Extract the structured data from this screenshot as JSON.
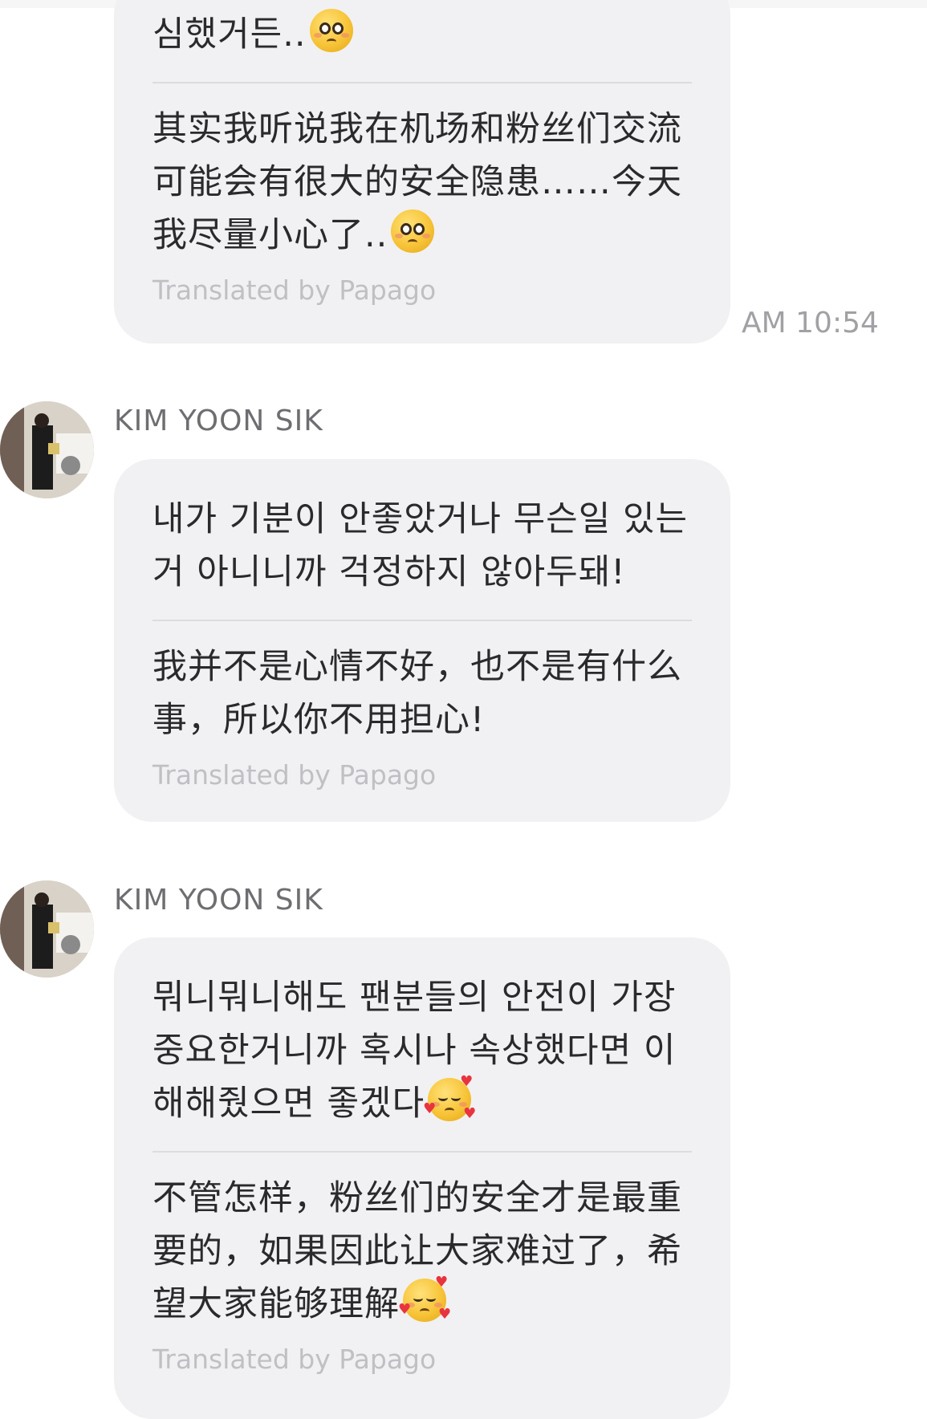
{
  "messages": [
    {
      "sender": "",
      "original": "심했거든..",
      "translated": "其实我听说我在机场和粉丝们交流可能会有很大的安全隐患……今天我尽量小心了..",
      "credit": "Translated by Papago",
      "time": "AM 10:54"
    },
    {
      "sender": "KIM YOON SIK",
      "original": "내가 기분이 안좋았거나 무슨일 있는 거 아니니까 걱정하지 않아두돼!",
      "translated": "我并不是心情不好，也不是有什么事，所以你不用担心!",
      "credit": "Translated by Papago"
    },
    {
      "sender": "KIM YOON SIK",
      "original": "뭐니뭐니해도 팬분들의 안전이 가장 중요한거니까 혹시나 속상했다면 이해해줬으면 좋겠다",
      "translated": "不管怎样，粉丝们的安全才是最重要的，如果因此让大家难过了，希望大家能够理解",
      "credit": "Translated by Papago"
    }
  ],
  "icons": {
    "pleading": "pleading-face-emoji",
    "hearts": "smiling-face-with-hearts-emoji",
    "avatar": "profile-photo"
  },
  "colors": {
    "bubble": "#f1f1f3",
    "text": "#2a2a2c",
    "credit": "#c0c0c4",
    "meta": "#6e6e72"
  }
}
